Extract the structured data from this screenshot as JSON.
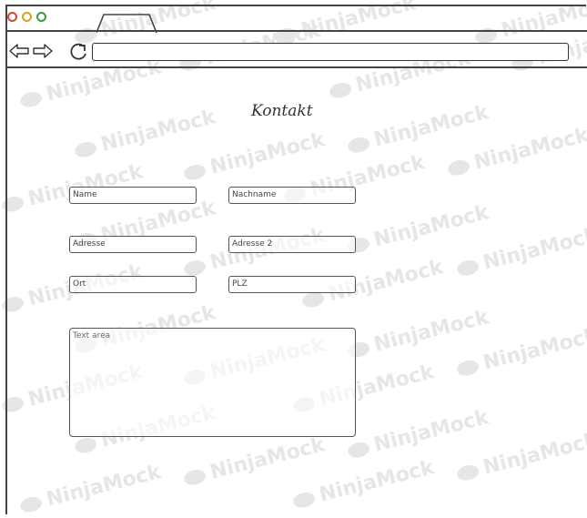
{
  "window": {
    "tab_label": "",
    "address_value": ""
  },
  "watermark": {
    "text": "NinjaMock"
  },
  "form": {
    "title": "Kontakt",
    "fields": {
      "name": "Name",
      "nachname": "Nachname",
      "adresse": "Adresse",
      "adresse2": "Adresse 2",
      "ort": "Ort",
      "plz": "PLZ",
      "textarea": "Text area"
    }
  },
  "colors": {
    "red_dot": "#d04a3a",
    "yellow_dot": "#d6a021",
    "green_dot": "#3f9b3f",
    "line": "#444444"
  }
}
